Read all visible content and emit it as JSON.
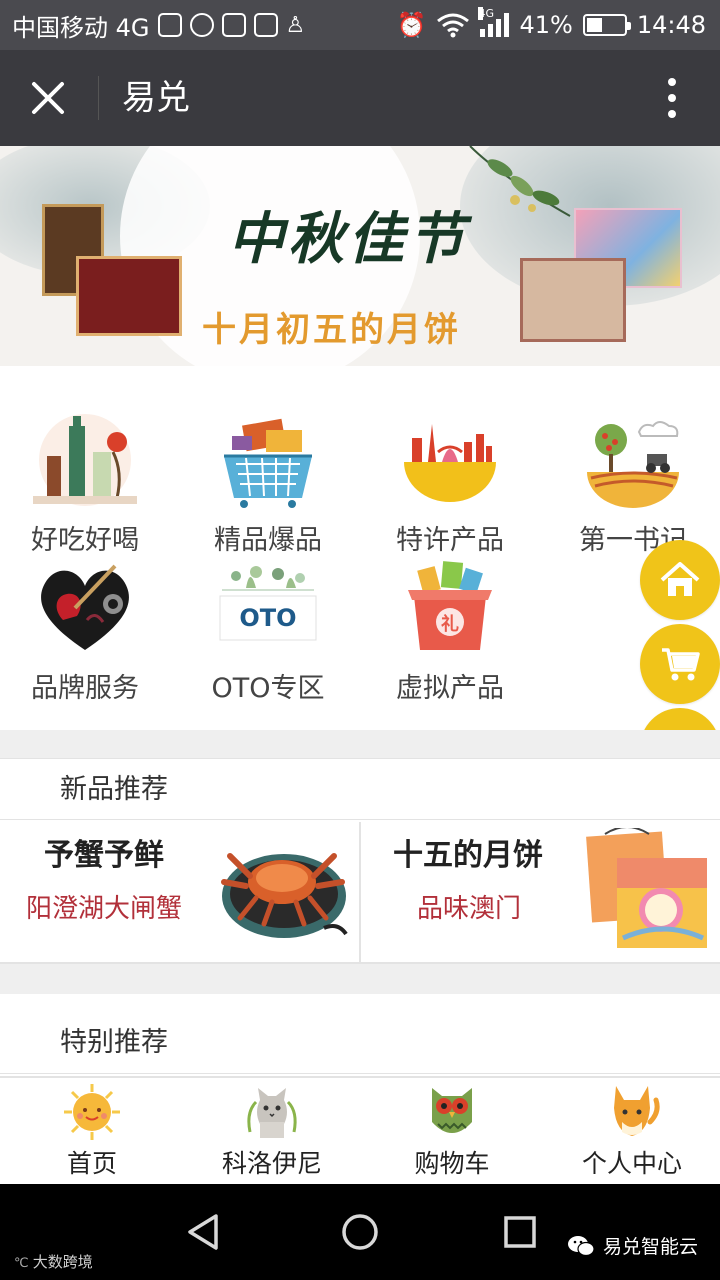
{
  "status_bar": {
    "carrier": "中国移动 4G",
    "network_badge": "4G",
    "battery": "41%",
    "battery_level": 0.41,
    "time": "14:48"
  },
  "header": {
    "title": "易兑",
    "close_icon": "close-icon",
    "more_icon": "more-vertical-icon"
  },
  "banner": {
    "headline": "中秋佳节",
    "subtitle": "十月初五的月饼"
  },
  "categories": [
    {
      "label": "好吃好喝",
      "icon": "food-drink-icon"
    },
    {
      "label": "精品爆品",
      "icon": "shopping-basket-icon"
    },
    {
      "label": "特许产品",
      "icon": "landmark-icon"
    },
    {
      "label": "第一书记",
      "icon": "farm-icon"
    },
    {
      "label": "品牌服务",
      "icon": "guitar-heart-icon"
    },
    {
      "label": "OTO专区",
      "icon": "oto-icon"
    },
    {
      "label": "虚拟产品",
      "icon": "gift-box-icon"
    }
  ],
  "oto_badge": "OTO",
  "gift_badge": "礼",
  "floating_buttons": [
    {
      "name": "home-icon"
    },
    {
      "name": "cart-icon"
    },
    {
      "name": "heart-icon"
    }
  ],
  "sections": {
    "new": "新品推荐",
    "special": "特别推荐"
  },
  "promos": [
    {
      "title": "予蟹予鲜",
      "subtitle": "阳澄湖大闸蟹",
      "image": "crab-image"
    },
    {
      "title": "十五的月饼",
      "subtitle": "品味澳门",
      "image": "mooncake-box-image"
    }
  ],
  "tabs": [
    {
      "label": "首页",
      "icon": "sun-face-icon"
    },
    {
      "label": "科洛伊尼",
      "icon": "cat-icon"
    },
    {
      "label": "购物车",
      "icon": "owl-icon"
    },
    {
      "label": "个人中心",
      "icon": "fox-icon"
    }
  ],
  "watermarks": {
    "left": "大数跨境",
    "right": "易兑智能云"
  },
  "colors": {
    "accent_yellow": "#f0c419",
    "promo_red": "#b2303a",
    "header_bg": "#3a3a3f"
  }
}
